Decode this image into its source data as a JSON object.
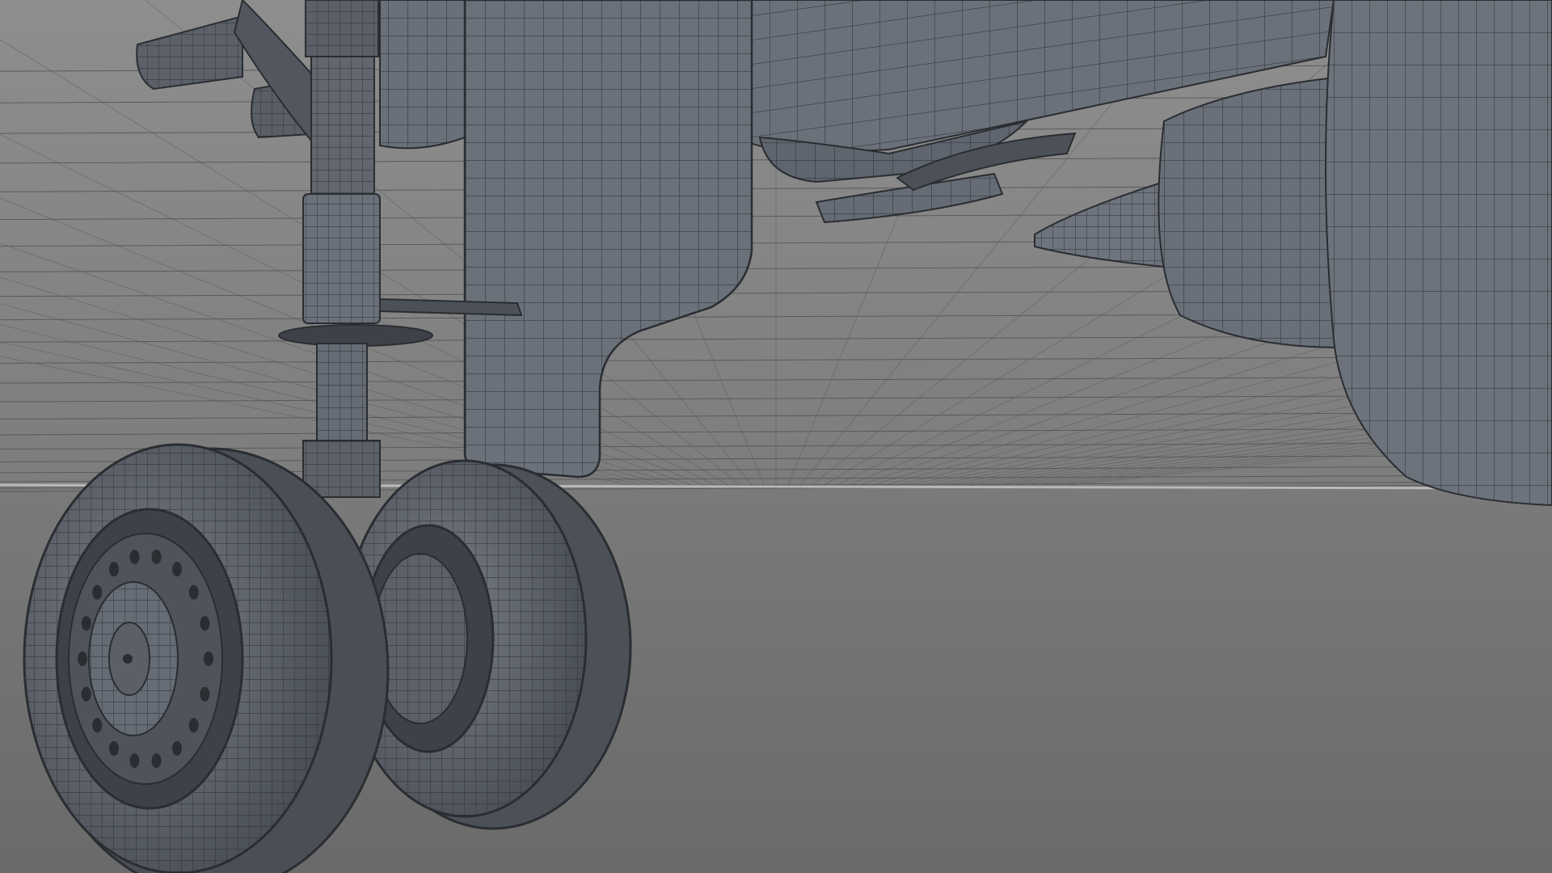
{
  "viewport": {
    "label": "",
    "background_color": "#6f6f6f",
    "sky_color": "#8b8b8b",
    "mesh_fill_color": "#6b717a",
    "mesh_dark_color": "#3e4248",
    "wire_color": "#2a2d31",
    "grid_line_color": "#5a5a5a",
    "horizon_color": "#b9b9b9"
  },
  "scene": {
    "objects": [
      {
        "name": "landing-gear-strut"
      },
      {
        "name": "main-wheel-front"
      },
      {
        "name": "main-wheel-rear"
      },
      {
        "name": "gear-door"
      },
      {
        "name": "wing-underside"
      },
      {
        "name": "jet-engine-nacelle"
      },
      {
        "name": "engine-exhaust-cone"
      }
    ]
  }
}
